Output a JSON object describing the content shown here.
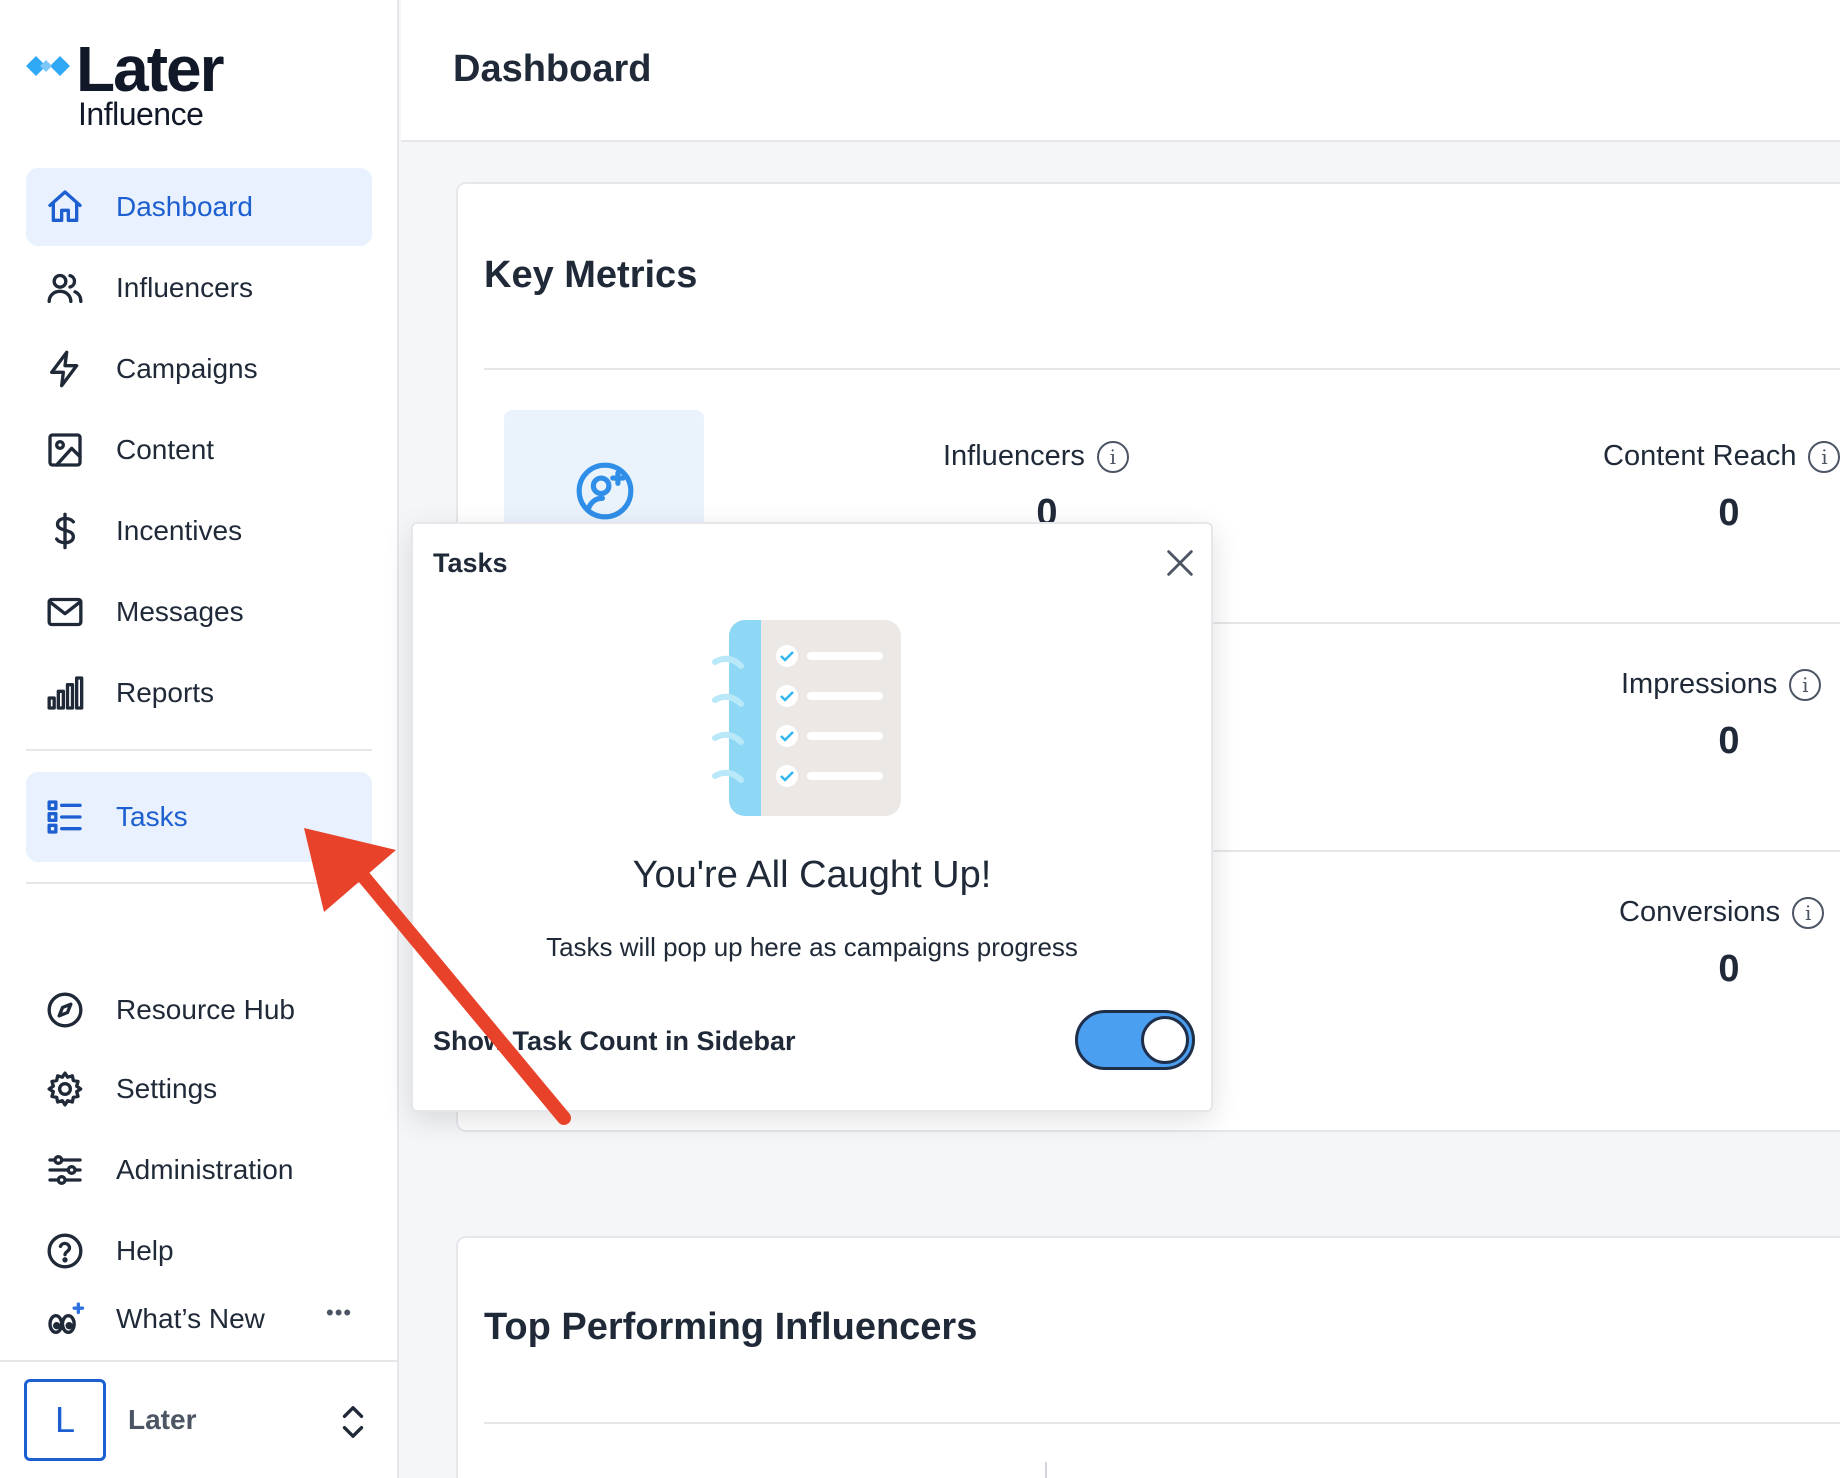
{
  "brand": {
    "name": "Later",
    "sub": "Influence",
    "accent": "#1d5fd1",
    "logo_color": "#2fa8f5"
  },
  "sidebar": {
    "items": [
      {
        "key": "dashboard",
        "label": "Dashboard",
        "icon": "home-icon",
        "active": true
      },
      {
        "key": "influencers",
        "label": "Influencers",
        "icon": "users-icon"
      },
      {
        "key": "campaigns",
        "label": "Campaigns",
        "icon": "lightning-icon"
      },
      {
        "key": "content",
        "label": "Content",
        "icon": "image-icon"
      },
      {
        "key": "incentives",
        "label": "Incentives",
        "icon": "dollar-icon"
      },
      {
        "key": "messages",
        "label": "Messages",
        "icon": "mail-icon"
      },
      {
        "key": "reports",
        "label": "Reports",
        "icon": "bar-chart-icon"
      }
    ],
    "tasks": {
      "label": "Tasks",
      "icon": "list-icon"
    },
    "bottom_items": [
      {
        "key": "resource-hub",
        "label": "Resource Hub",
        "icon": "compass-icon"
      },
      {
        "key": "settings",
        "label": "Settings",
        "icon": "gear-icon"
      },
      {
        "key": "administration",
        "label": "Administration",
        "icon": "sliders-icon"
      },
      {
        "key": "help",
        "label": "Help",
        "icon": "help-icon"
      }
    ],
    "whats_new": {
      "label": "What’s New",
      "icon": "sparkle-eyes-icon"
    },
    "more": "•••",
    "account": {
      "initial": "L",
      "name": "Later"
    }
  },
  "header": {
    "title": "Dashboard"
  },
  "metrics_card": {
    "title": "Key Metrics",
    "metrics": [
      {
        "label": "Influencers",
        "value": "0"
      },
      {
        "label": "Content Reach",
        "value": "0"
      },
      {
        "label": "Impressions",
        "value": "0"
      },
      {
        "label": "Conversions",
        "value": "0"
      }
    ]
  },
  "top_card": {
    "title": "Top Performing Influencers"
  },
  "tasks_popover": {
    "title": "Tasks",
    "heading": "You're All Caught Up!",
    "body": "Tasks will pop up here as campaigns progress",
    "toggle_label": "Show Task Count in Sidebar",
    "toggle_on": true
  }
}
